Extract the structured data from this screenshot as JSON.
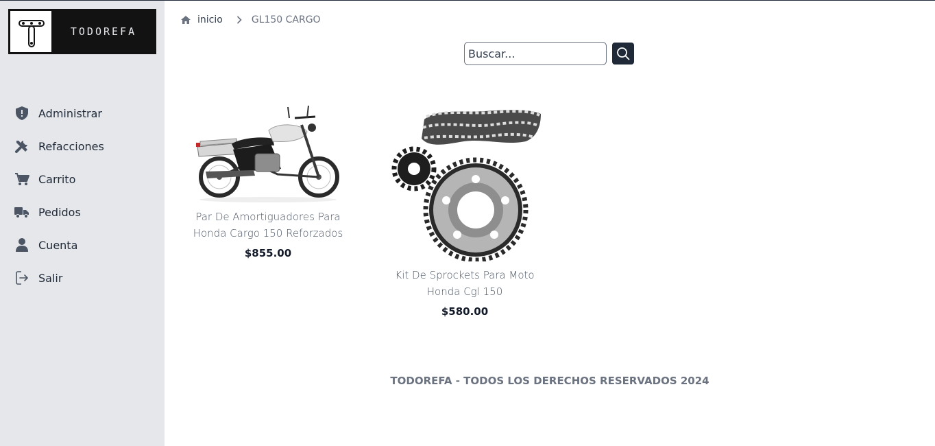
{
  "logo": {
    "text": "TODOREFA"
  },
  "sidebar": {
    "items": [
      {
        "label": "Administrar",
        "icon": "shield-icon"
      },
      {
        "label": "Refacciones",
        "icon": "tools-icon"
      },
      {
        "label": "Carrito",
        "icon": "cart-icon"
      },
      {
        "label": "Pedidos",
        "icon": "truck-icon"
      },
      {
        "label": "Cuenta",
        "icon": "user-icon"
      },
      {
        "label": "Salir",
        "icon": "logout-icon"
      }
    ]
  },
  "breadcrumb": {
    "home": "inicio",
    "current": "GL150 CARGO"
  },
  "search": {
    "placeholder": "Buscar...",
    "value": ""
  },
  "products": [
    {
      "name": "Par De Amortiguadores Para Honda Cargo 150 Reforzados",
      "price": "$855.00",
      "image": "motorcycle-image"
    },
    {
      "name": "Kit De Sprockets Para Moto Honda Cgl 150",
      "price": "$580.00",
      "image": "sprocket-kit-image"
    }
  ],
  "footer": {
    "text": "TODOREFA - TODOS LOS DERECHOS RESERVADOS 2024"
  },
  "colors": {
    "sidebar_bg": "#e5e7eb",
    "accent": "#1f2937",
    "icon": "#4b5563"
  }
}
